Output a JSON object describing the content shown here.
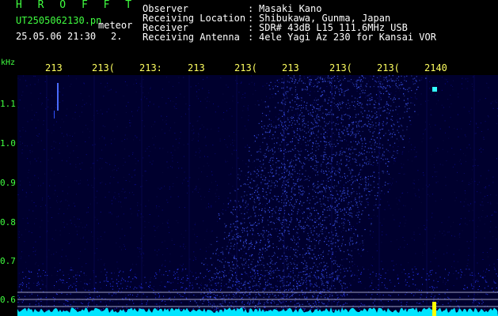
{
  "header": {
    "title": "H R O F F T",
    "filename": "UT2505062130.pn",
    "mode": "meteor",
    "datetime": "25.05.06 21:30",
    "number": "2."
  },
  "meta": {
    "labels": [
      "Observer",
      "Receiving Location",
      "Receiver",
      "Receiving Antenna"
    ],
    "colons": [
      ":",
      ":",
      ":",
      ":"
    ],
    "values": [
      "Masaki Kano",
      "Shibukawa, Gunma, Japan",
      "SDR# 43dB L15 111.6MHz USB",
      "4ele Yagi Az 230 for Kansai VOR"
    ]
  },
  "axes": {
    "y_unit": "kHz",
    "x_ticks": [
      "213",
      "213(",
      "213:",
      "213",
      "213(",
      "213",
      "213(",
      "213(",
      "2140"
    ],
    "y_ticks": [
      "1.1",
      "1.0",
      "0.9",
      "0.8",
      "0.7",
      "0.6"
    ]
  },
  "colors": {
    "background": "#000000",
    "plot_bg": "#00002e",
    "text_green": "#40ff40",
    "tick_yellow": "#ffff60",
    "signal_blue": "#2a3bff",
    "baseline_cyan": "#00e5ff",
    "echo_highlight": "#ffff00"
  }
}
